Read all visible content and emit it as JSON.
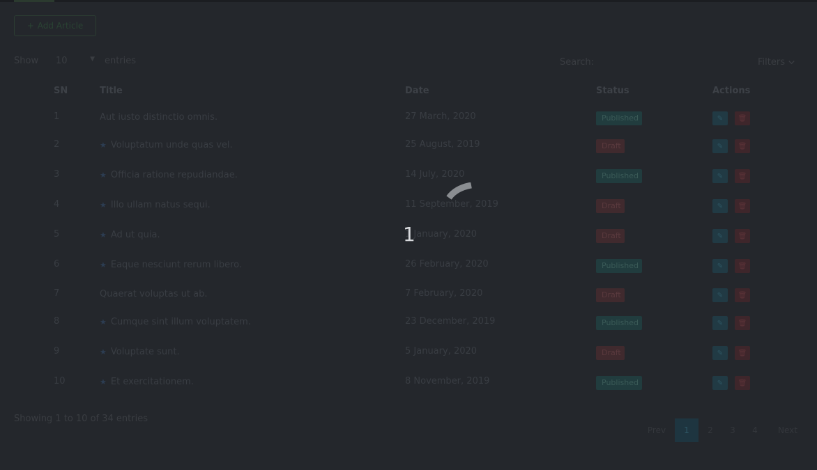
{
  "toolbar": {
    "add_button_label": "Add Article",
    "show_label": "Show",
    "page_length": "10",
    "entries_label": "entries",
    "search_label": "Search:",
    "filters_label": "Filters"
  },
  "table": {
    "columns": [
      "SN",
      "Title",
      "Date",
      "Status",
      "Actions"
    ],
    "rows": [
      {
        "sn": "1",
        "title": "Aut iusto distinctio omnis.",
        "featured": false,
        "date": "27 March, 2020",
        "status": "Published"
      },
      {
        "sn": "2",
        "title": "Voluptatum unde quas vel.",
        "featured": true,
        "date": "25 August, 2019",
        "status": "Draft"
      },
      {
        "sn": "3",
        "title": "Officia ratione repudiandae.",
        "featured": true,
        "date": "14 July, 2020",
        "status": "Published"
      },
      {
        "sn": "4",
        "title": "Illo ullam natus sequi.",
        "featured": true,
        "date": "11 September, 2019",
        "status": "Draft"
      },
      {
        "sn": "5",
        "title": "Ad ut quia.",
        "featured": true,
        "date": "1 January, 2020",
        "status": "Draft"
      },
      {
        "sn": "6",
        "title": "Eaque nesciunt rerum libero.",
        "featured": true,
        "date": "26 February, 2020",
        "status": "Published"
      },
      {
        "sn": "7",
        "title": "Quaerat voluptas ut ab.",
        "featured": false,
        "date": "7 February, 2020",
        "status": "Draft"
      },
      {
        "sn": "8",
        "title": "Cumque sint illum voluptatem.",
        "featured": true,
        "date": "23 December, 2019",
        "status": "Published"
      },
      {
        "sn": "9",
        "title": "Voluptate sunt.",
        "featured": true,
        "date": "5 January, 2020",
        "status": "Draft"
      },
      {
        "sn": "10",
        "title": "Et exercitationem.",
        "featured": true,
        "date": "8 November, 2019",
        "status": "Published"
      }
    ]
  },
  "footer": {
    "info": "Showing 1 to 10 of 34 entries"
  },
  "pagination": {
    "prev": "Prev",
    "pages": [
      "1",
      "2",
      "3",
      "4"
    ],
    "active_page": "1",
    "next": "Next"
  },
  "loader": {
    "value": "1"
  },
  "colors": {
    "overlay_background": "#24272c",
    "published_badge": "#213c3e",
    "draft_badge": "#402a2e",
    "active_page": "#1e3540"
  },
  "icons": {
    "featured": "star-icon",
    "edit": "edit-icon",
    "delete": "trash-icon",
    "filters": "chevron-down-icon",
    "add": "plus-icon"
  }
}
